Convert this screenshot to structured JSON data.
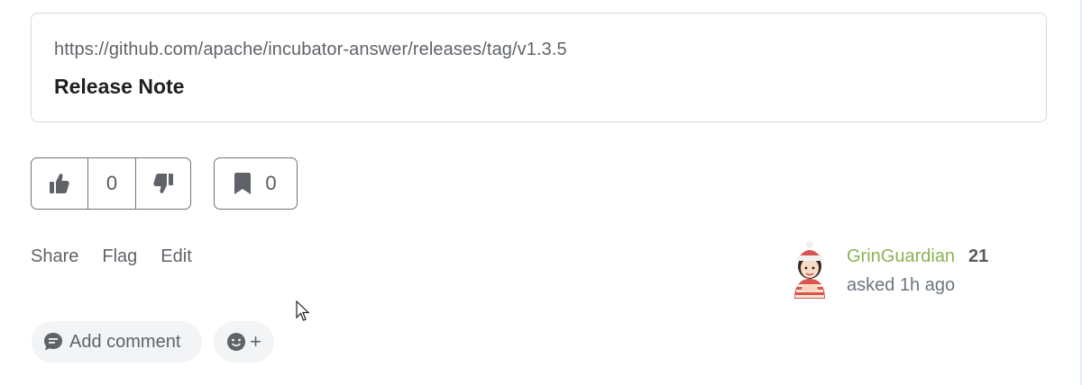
{
  "link_preview": {
    "url": "https://github.com/apache/incubator-answer/releases/tag/v1.3.5",
    "title": "Release Note"
  },
  "votes": {
    "count": "0",
    "upvote_icon": "thumbs-up-icon",
    "downvote_icon": "thumbs-down-icon"
  },
  "bookmark": {
    "count": "0",
    "icon": "bookmark-icon"
  },
  "actions": {
    "share": "Share",
    "flag": "Flag",
    "edit": "Edit"
  },
  "author": {
    "name": "GrinGuardian",
    "reputation": "21",
    "asked": "asked 1h ago",
    "name_color": "#8bb353"
  },
  "comment": {
    "add_label": "Add comment",
    "icon": "comment-icon"
  },
  "reaction": {
    "plus": "+",
    "icon": "smiley-icon"
  }
}
